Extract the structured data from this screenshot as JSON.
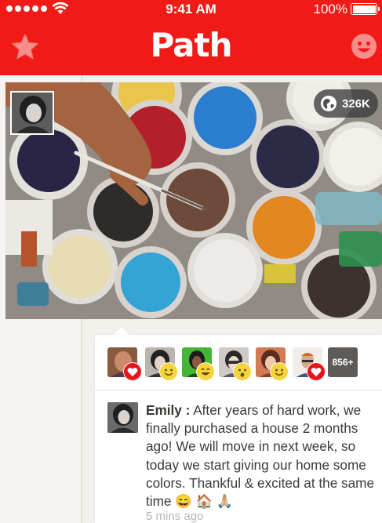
{
  "status_bar": {
    "time": "9:41 AM",
    "battery": "100%"
  },
  "nav": {
    "title": "Path",
    "left_icon": "star-icon",
    "right_icon": "smiley-icon"
  },
  "photo": {
    "views": "326K",
    "views_icon": "globe-icon"
  },
  "reactions": {
    "more_count": "856+",
    "items": [
      {
        "badge": "heart"
      },
      {
        "badge": "smile"
      },
      {
        "badge": "laugh"
      },
      {
        "badge": "surprised"
      },
      {
        "badge": "smile"
      },
      {
        "badge": "heart"
      }
    ]
  },
  "post": {
    "author": "Emily :",
    "text": "After years of hard work, we finally purchased a house 2 months ago! We will move in next week, so today we start giving our home some colors.  Thankful & excited at the same time",
    "emoji": "😄 🏠 🙏🏼",
    "timestamp": "5 mins ago"
  },
  "colors": {
    "brand_red": "#f01b16",
    "heart_red": "#e8141b",
    "smile_yellow": "#f7d43b"
  }
}
